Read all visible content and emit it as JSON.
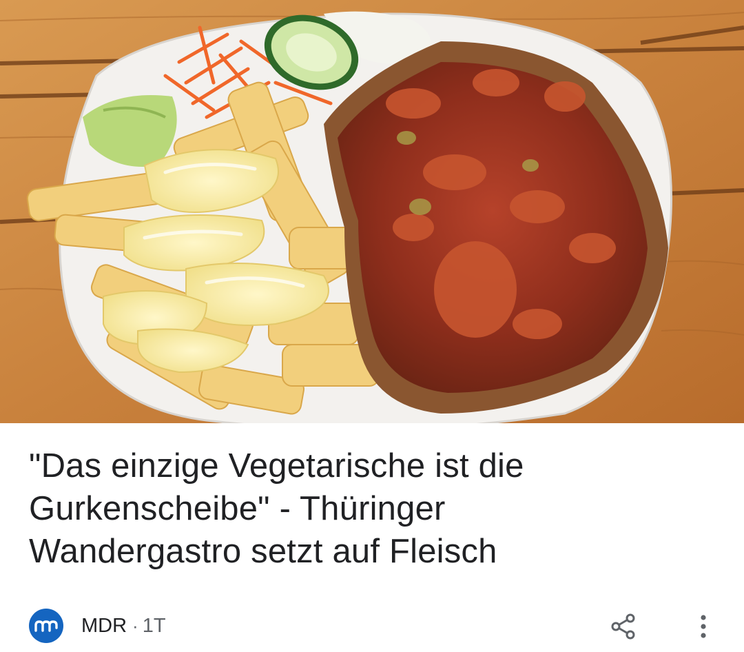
{
  "article": {
    "image_alt": "Schnitzel mit Tomatensauce, Pommes frites mit Mayonnaise und Salat",
    "headline": "\"Das einzige Vegetarische ist die Gurkenscheibe\" - Thüringer Wandergastro setzt auf Fleisch",
    "source": {
      "name": "MDR",
      "separator": "·",
      "age": "1T",
      "logo_icon": "mdr-logo-icon",
      "logo_color": "#1565c0"
    },
    "actions": {
      "share_icon": "share-icon",
      "more_icon": "more-vert-icon"
    }
  },
  "colors": {
    "text_primary": "#202124",
    "text_secondary": "#5f6368"
  }
}
